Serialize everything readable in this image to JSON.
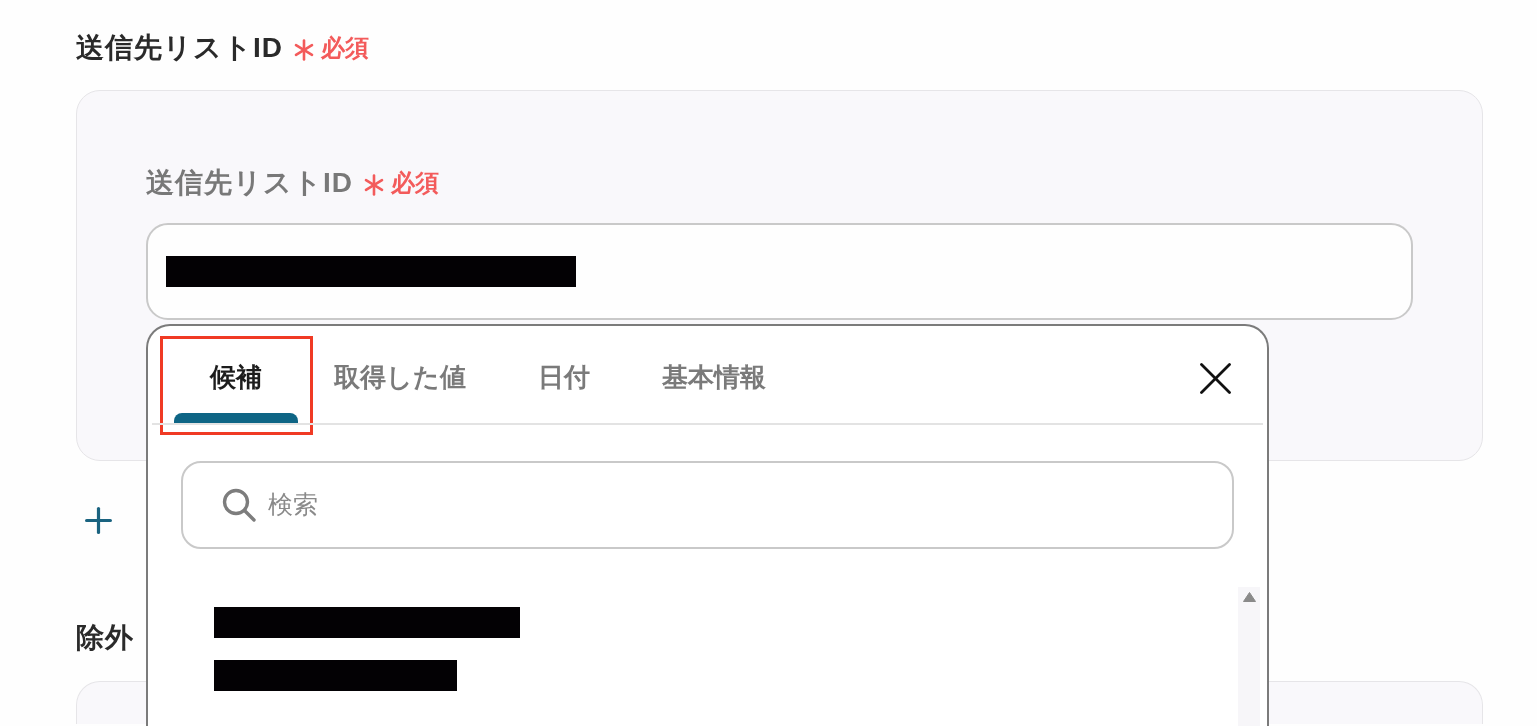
{
  "field": {
    "title": "送信先リストID",
    "required": true,
    "required_label": "必須"
  },
  "card": {
    "label": "送信先リストID",
    "required": true,
    "required_label": "必須",
    "input": {
      "redacted": true
    }
  },
  "next_field": {
    "title": "除外"
  },
  "dropdown": {
    "tabs": [
      {
        "label": "候補",
        "selected": true,
        "highlighted": true
      },
      {
        "label": "取得した値",
        "selected": false,
        "highlighted": false
      },
      {
        "label": "日付",
        "selected": false,
        "highlighted": false
      },
      {
        "label": "基本情報",
        "selected": false,
        "highlighted": false
      }
    ],
    "search": {
      "placeholder": "検索"
    },
    "options": [
      {
        "kind": "redacted"
      }
    ]
  }
}
